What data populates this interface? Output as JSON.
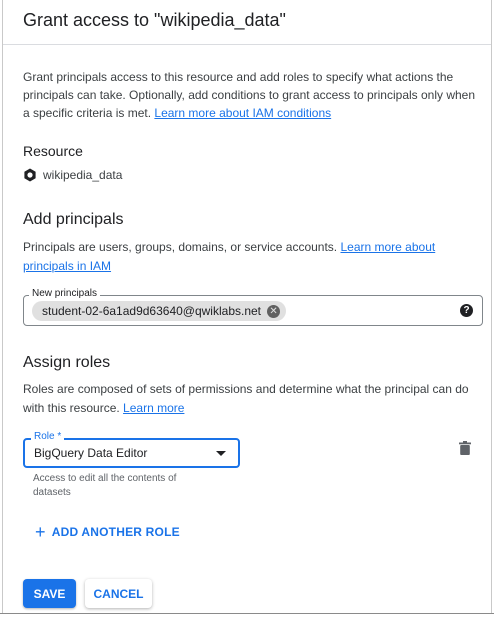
{
  "dialog": {
    "title": "Grant access to \"wikipedia_data\"",
    "intro_text": "Grant principals access to this resource and add roles to specify what actions the principals can take. Optionally, add conditions to grant access to principals only when a specific criteria is met.",
    "intro_link": "Learn more about IAM conditions"
  },
  "resource": {
    "heading": "Resource",
    "icon": "bigquery-dataset-icon",
    "name": "wikipedia_data"
  },
  "principals": {
    "heading": "Add principals",
    "description": "Principals are users, groups, domains, or service accounts.",
    "link": "Learn more about principals in IAM",
    "field_label": "New principals",
    "chip": "student-02-6a1ad9d63640@qwiklabs.net",
    "help_icon": "help-icon"
  },
  "roles": {
    "heading": "Assign roles",
    "description": "Roles are composed of sets of permissions and determine what the principal can do with this resource.",
    "link": "Learn more",
    "field_label": "Role *",
    "selected": "BigQuery Data Editor",
    "helper": "Access to edit all the contents of datasets",
    "add_another": "ADD ANOTHER ROLE"
  },
  "actions": {
    "save": "SAVE",
    "cancel": "CANCEL"
  },
  "colors": {
    "accent": "#1a73e8",
    "text": "#202124"
  }
}
